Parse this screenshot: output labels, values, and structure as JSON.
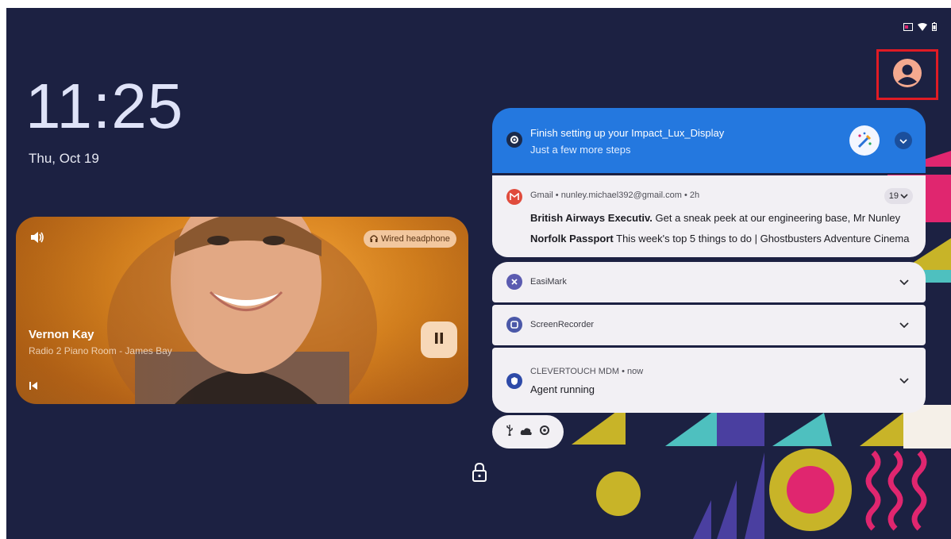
{
  "clock": {
    "time": "11:25",
    "date": "Thu, Oct 19"
  },
  "status_bar": {
    "icons": [
      "cast-icon",
      "wifi-icon",
      "battery-icon"
    ]
  },
  "user": {
    "icon": "account-circle-icon"
  },
  "media": {
    "title": "Vernon Kay",
    "subtitle": "Radio 2 Piano Room - James Bay",
    "output": "Wired headphone",
    "icons": [
      "volume-icon",
      "headphones-icon",
      "pause-icon",
      "previous-icon"
    ]
  },
  "notifications": {
    "setup": {
      "title": "Finish setting up your Impact_Lux_Display",
      "text": "Just a few more steps",
      "icons": [
        "settings-icon",
        "magic-wand-icon",
        "chevron-down-icon"
      ]
    },
    "gmail": {
      "header": "Gmail • nunley.michael392@gmail.com • 2h",
      "count": "19",
      "messages": [
        {
          "sender": "British Airways Executiv.",
          "preview": "Get a sneak peek at our engineering base, Mr Nunley"
        },
        {
          "sender": "Norfolk Passport",
          "preview": "This week's top 5 things to do | Ghostbusters Adventure Cinema"
        }
      ]
    },
    "easimark": {
      "app": "EasiMark"
    },
    "screenrecorder": {
      "app": "ScreenRecorder"
    },
    "mdm": {
      "header": "CLEVERTOUCH MDM • now",
      "text": "Agent running"
    }
  },
  "quick_pill": {
    "icons": [
      "usb-icon",
      "cloud-icon",
      "gear-icon"
    ]
  },
  "lock": {
    "icon": "lock-icon"
  },
  "colors": {
    "background": "#1c2142",
    "setup_card": "#2478df",
    "notification_card": "#f2f0f4",
    "media_card": "#d98420",
    "highlight_box": "#e01b24"
  }
}
